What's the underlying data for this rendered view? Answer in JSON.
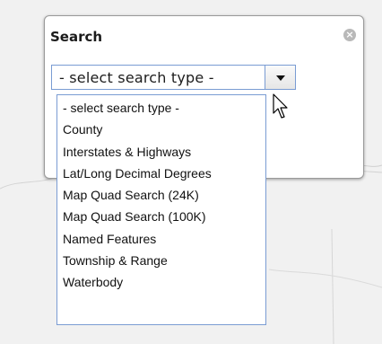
{
  "panel": {
    "title": "Search",
    "close_icon": "close-circle-icon"
  },
  "search_type_select": {
    "selected": "- select search type -",
    "arrow_icon": "chevron-down-icon",
    "options": [
      "- select search type -",
      "County",
      "Interstates & Highways",
      "Lat/Long Decimal Degrees",
      "Map Quad Search (24K)",
      "Map Quad Search (100K)",
      "Named Features",
      "Township & Range",
      "Waterbody"
    ]
  },
  "colors": {
    "select_border": "#7a9cd3",
    "panel_border": "#9a9a9a",
    "map_background": "#f1f1f1"
  }
}
